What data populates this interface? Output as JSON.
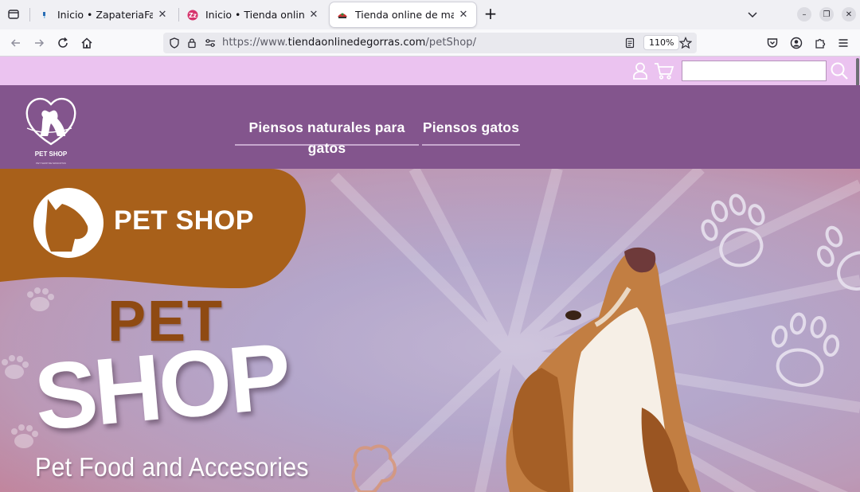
{
  "browser": {
    "tabs": [
      {
        "title": "Inicio • ZapateriaFashion",
        "active": false
      },
      {
        "title": "Inicio • Tienda online de r",
        "active": false
      },
      {
        "title": "Tienda online de mascota",
        "active": true
      }
    ],
    "url_prefix": "https://www.",
    "url_domain": "tiendaonlinedegorras.com",
    "url_path": "/petShop/",
    "zoom": "110%"
  },
  "site": {
    "search": {
      "value": "",
      "placeholder": ""
    },
    "logo_name": "PET SHOP",
    "logo_tagline": "PET SHOP DE MASCOTAS",
    "menu": [
      {
        "label": "Piensos naturales para gatos"
      },
      {
        "label": "Piensos gatos"
      }
    ]
  },
  "hero": {
    "brand": "PET SHOP",
    "pet": "PET",
    "shop": "SHOP",
    "subtitle": "Pet Food and Accesories"
  },
  "colors": {
    "topbar": "#ebc3f0",
    "header": "#83558d",
    "hero_banner": "#a8601a",
    "pet_text": "#8f4a12"
  }
}
